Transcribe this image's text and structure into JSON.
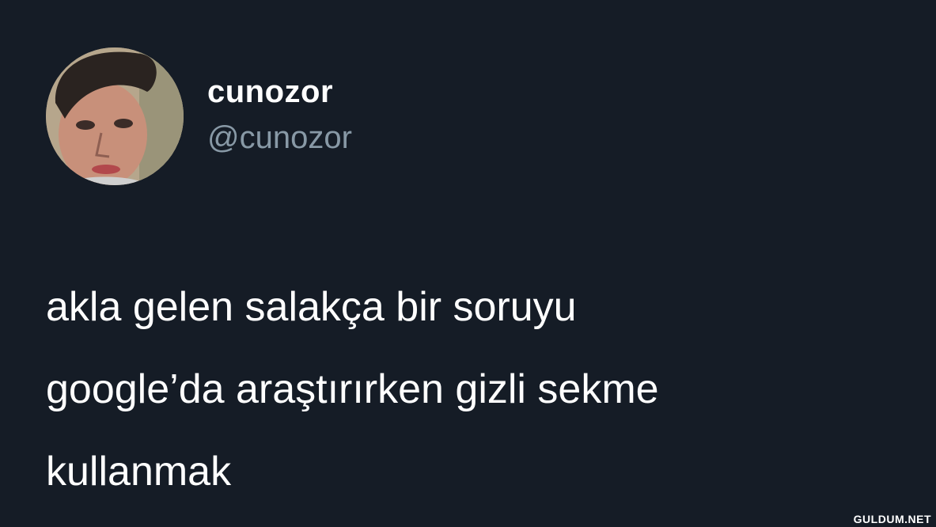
{
  "tweet": {
    "display_name": "cunozor",
    "handle": "@cunozor",
    "text_lines": [
      "akla gelen salakça bir soruyu",
      "google’da araştırırken gizli sekme",
      "kullanmak"
    ]
  },
  "watermark": "GULDUM.NET",
  "colors": {
    "background": "#151c26",
    "name": "#ffffff",
    "handle": "#8899a6",
    "text": "#ffffff"
  }
}
